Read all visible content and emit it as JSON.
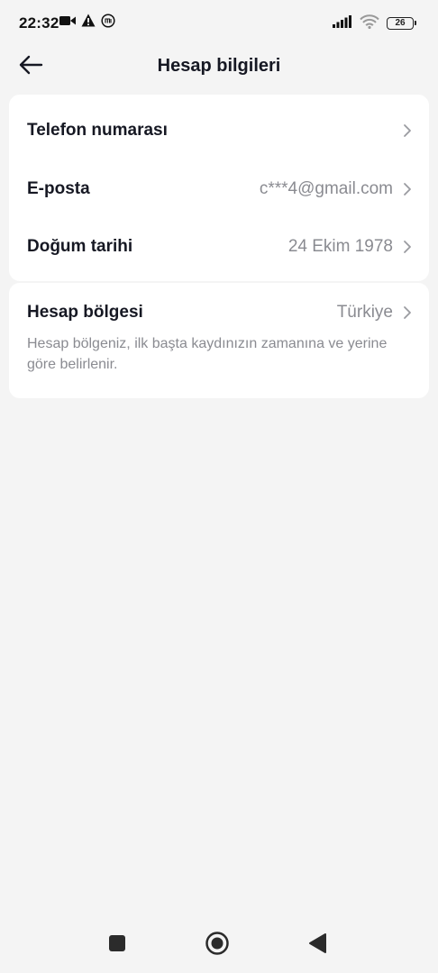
{
  "status_bar": {
    "time": "22:32",
    "battery_level": "26",
    "left_icons": [
      "video-camera-icon",
      "warning-icon",
      "mi-icon"
    ],
    "right_icons": [
      "signal-icon",
      "wifi-icon",
      "battery-icon"
    ]
  },
  "header": {
    "title": "Hesap bilgileri",
    "back_icon": "arrow-left-icon"
  },
  "account_rows": [
    {
      "label": "Telefon numarası",
      "value": ""
    },
    {
      "label": "E-posta",
      "value": "c***4@gmail.com"
    },
    {
      "label": "Doğum tarihi",
      "value": "24 Ekim 1978"
    }
  ],
  "region": {
    "label": "Hesap bölgesi",
    "value": "Türkiye",
    "description": "Hesap bölgeniz, ilk başta kaydınızın zamanına ve yerine göre belirlenir."
  },
  "nav_bar": {
    "buttons": [
      "recents-square-icon",
      "home-circle-icon",
      "back-triangle-icon"
    ]
  },
  "colors": {
    "background": "#f4f4f4",
    "card": "#ffffff",
    "primary_text": "#161823",
    "secondary_text": "#8a8b91"
  }
}
